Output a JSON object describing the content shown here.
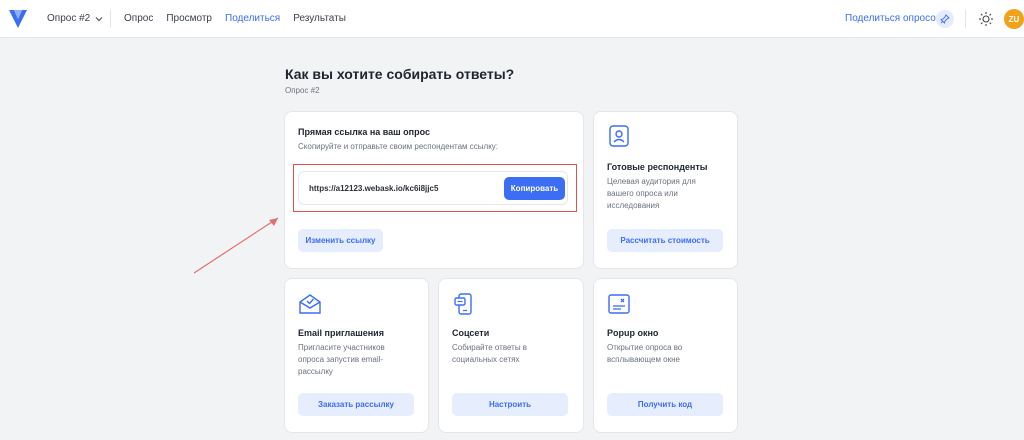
{
  "header": {
    "survey_name": "Опрос #2",
    "nav": [
      "Опрос",
      "Просмотр",
      "Поделиться",
      "Результаты"
    ],
    "active_nav": "Поделиться",
    "share_label": "Поделиться опросом",
    "avatar_initials": "ZU"
  },
  "page": {
    "title": "Как вы хотите собирать ответы?",
    "subtitle": "Опрос #2"
  },
  "direct_link": {
    "title": "Прямая ссылка на ваш опрос",
    "desc": "Скопируйте и отправьте своим респондентам ссылку:",
    "url": "https://a12123.webask.io/kc6i8jjc5",
    "copy_label": "Копировать",
    "edit_label": "Изменить ссылку"
  },
  "respondents": {
    "title": "Готовые респонденты",
    "desc": "Целевая аудитория для вашего опроса или исследования",
    "button": "Рассчитать стоимость"
  },
  "email": {
    "title": "Email приглашения",
    "desc": "Пригласите участников опроса запустив email-рассылку",
    "button": "Заказать рассылку"
  },
  "social": {
    "title": "Соцсети",
    "desc": "Собирайте ответы в социальных сетях",
    "button": "Настроить"
  },
  "popup": {
    "title": "Popup окно",
    "desc": "Открытие опроса во всплывающем окне",
    "button": "Получить код"
  },
  "colors": {
    "accent": "#3b6df5",
    "accent_soft": "#e6edfd",
    "highlight": "#e05252",
    "avatar": "#f0a21a"
  }
}
